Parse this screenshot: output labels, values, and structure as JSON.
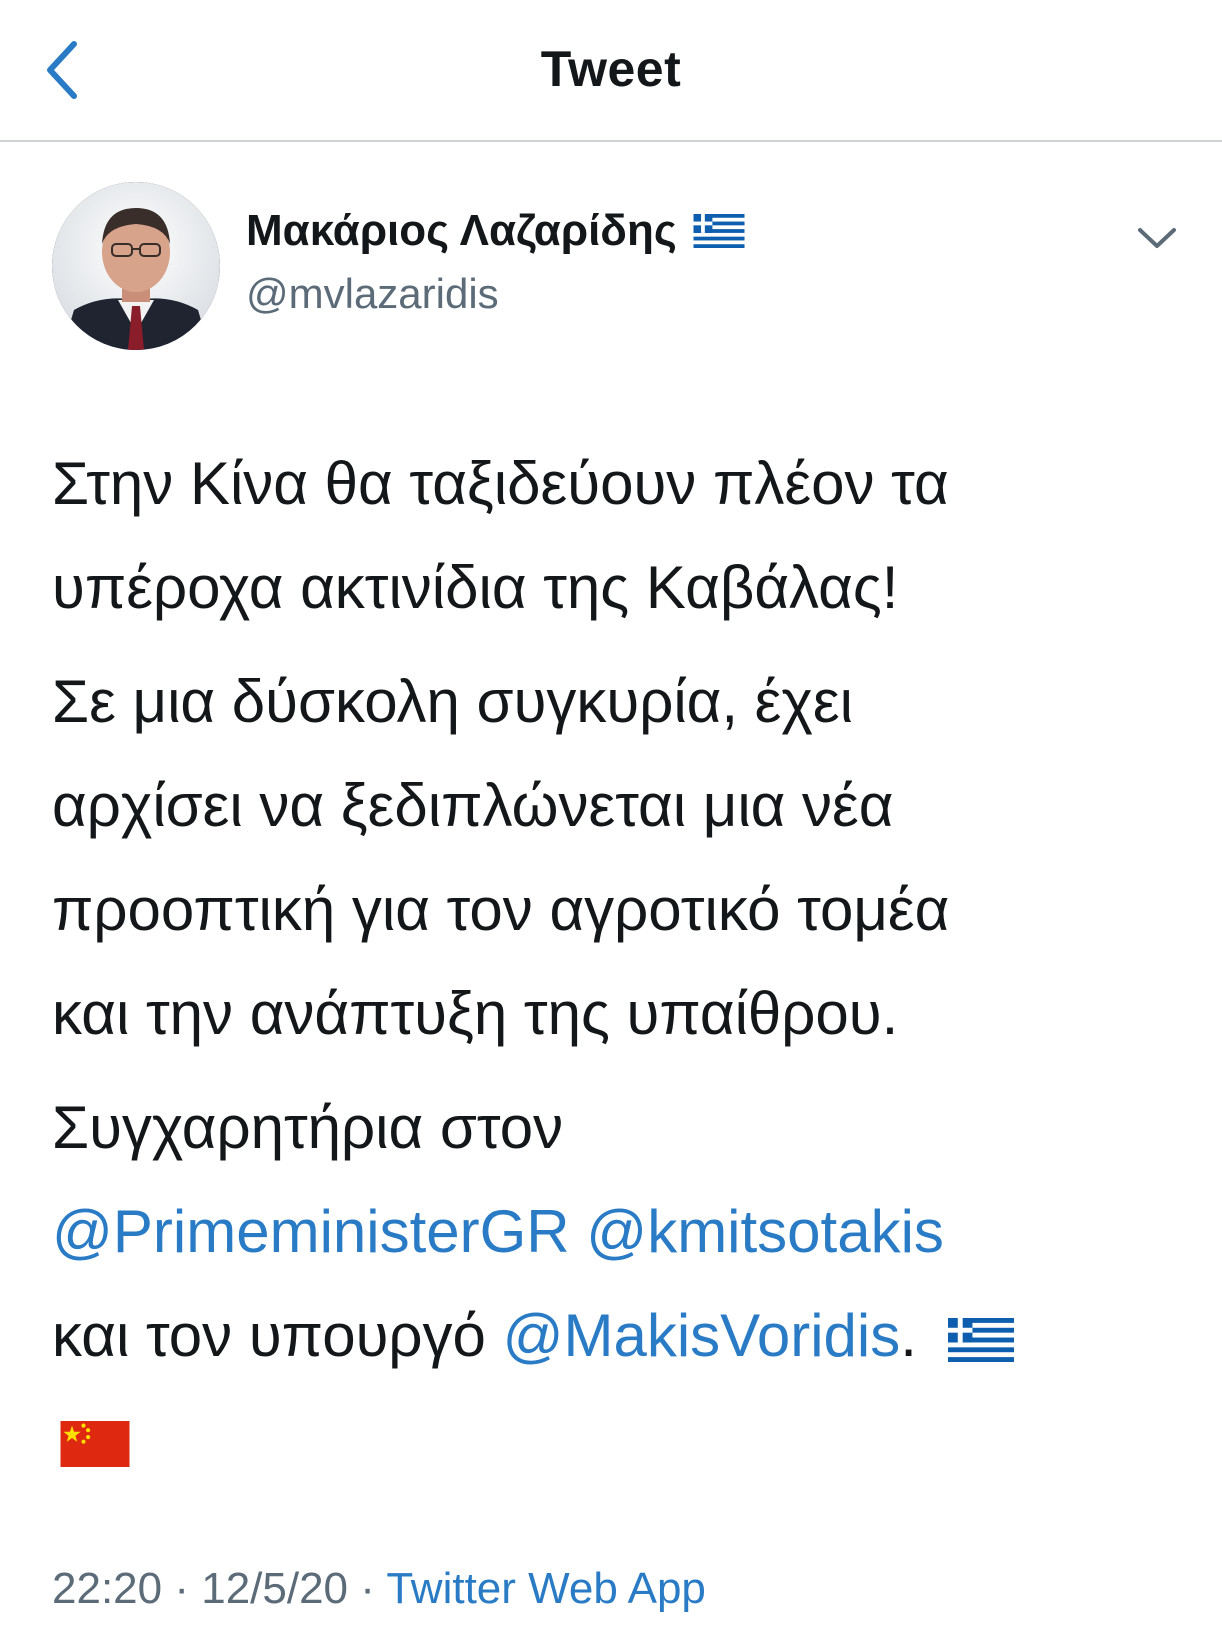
{
  "header": {
    "title": "Tweet",
    "back_icon": "chevron-left-icon"
  },
  "author": {
    "name": "Μακάριος Λαζαρίδης",
    "name_emoji": "greek-flag-icon",
    "handle": "@mvlazaridis",
    "menu_icon": "chevron-down-icon"
  },
  "tweet": {
    "p1_l1": "Στην Κίνα θα ταξιδεύουν πλέον τα",
    "p1_l2": "υπέροχα ακτινίδια της Καβάλας!",
    "p2_l1": "Σε μια δύσκολη συγκυρία, έχει",
    "p2_l2": "αρχίσει να ξεδιπλώνεται μια νέα",
    "p2_l3": "προοπτική για τον αγροτικό τομέα",
    "p2_l4": "και την ανάπτυξη της υπαίθρου.",
    "p3_l1": "Συγχαρητήρια στον",
    "mention1": "@PrimeministerGR",
    "mention2": "@kmitsotakis",
    "p3_l3_prefix": "και τον υπουργό ",
    "mention3": "@MakisVoridis",
    "p3_l3_suffix": ".",
    "emojis": [
      "greek-flag-icon",
      "chinese-flag-icon"
    ]
  },
  "meta": {
    "time": "22:20",
    "sep1": " · ",
    "date": "12/5/20",
    "sep2": " · ",
    "source": "Twitter Web App"
  },
  "colors": {
    "link": "#2a7bc5",
    "muted": "#5b6b78",
    "text": "#14171a"
  }
}
